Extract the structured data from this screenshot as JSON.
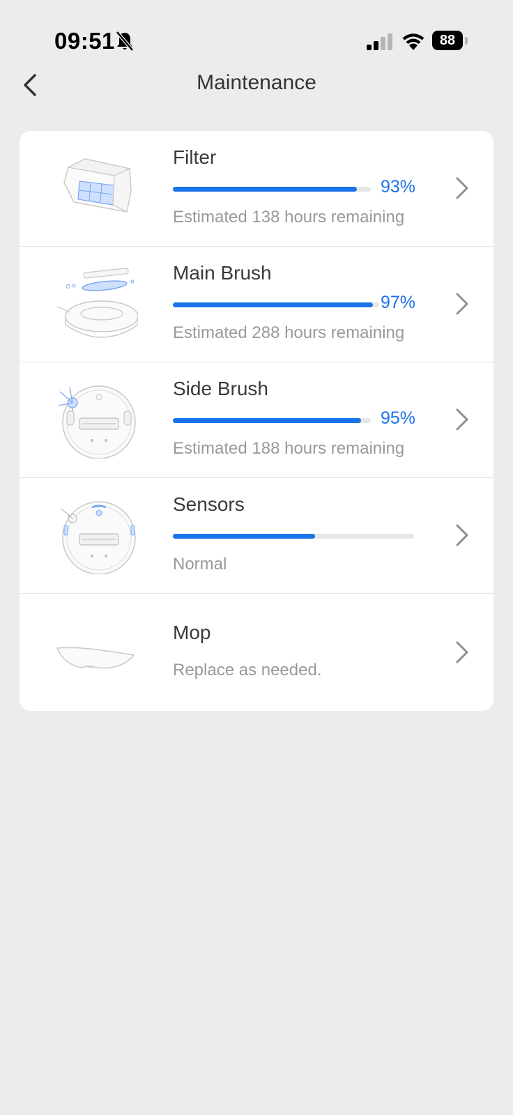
{
  "status_bar": {
    "time": "09:51",
    "battery": "88",
    "icons": [
      "bell-slash-icon",
      "signal-icon",
      "wifi-icon",
      "battery-icon"
    ]
  },
  "header": {
    "title": "Maintenance",
    "back_icon": "chevron-left-icon"
  },
  "colors": {
    "accent": "#1a73e8",
    "background": "#ececec",
    "card": "#ffffff",
    "track": "#e6e6e6",
    "subtext": "#999999"
  },
  "items": [
    {
      "title": "Filter",
      "percent_label": "93%",
      "progress": 0.93,
      "subtitle": "Estimated 138 hours remaining",
      "image": "filter-illustration"
    },
    {
      "title": "Main Brush",
      "percent_label": "97%",
      "progress": 0.97,
      "subtitle": "Estimated 288 hours remaining",
      "image": "main-brush-illustration"
    },
    {
      "title": "Side Brush",
      "percent_label": "95%",
      "progress": 0.95,
      "subtitle": "Estimated 188 hours remaining",
      "image": "side-brush-illustration"
    },
    {
      "title": "Sensors",
      "progress": 0.59,
      "subtitle": "Normal",
      "image": "sensors-illustration"
    },
    {
      "title": "Mop",
      "subtitle": "Replace as needed.",
      "image": "mop-illustration"
    }
  ]
}
